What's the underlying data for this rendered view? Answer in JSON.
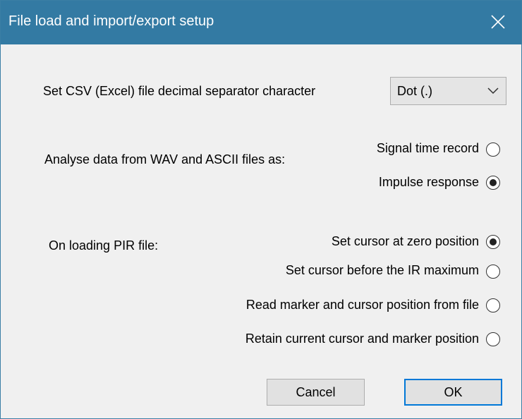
{
  "window": {
    "title": "File load and import/export setup"
  },
  "csv": {
    "label": "Set CSV (Excel) file decimal separator character",
    "selected": "Dot (.)"
  },
  "analyse": {
    "label": "Analyse data from WAV and ASCII files as:",
    "options": [
      {
        "label": "Signal time record",
        "checked": false
      },
      {
        "label": "Impulse response",
        "checked": true
      }
    ]
  },
  "pir": {
    "label": "On loading PIR file:",
    "options": [
      {
        "label": "Set cursor at zero position",
        "checked": true
      },
      {
        "label": "Set cursor before the IR maximum",
        "checked": false
      },
      {
        "label": "Read marker and cursor position from file",
        "checked": false
      },
      {
        "label": "Retain current cursor and marker position",
        "checked": false
      }
    ]
  },
  "buttons": {
    "cancel": "Cancel",
    "ok": "OK"
  },
  "colors": {
    "titlebar": "#337aa3",
    "dialog_bg": "#f0f0f0",
    "default_button_border": "#0078d7"
  }
}
